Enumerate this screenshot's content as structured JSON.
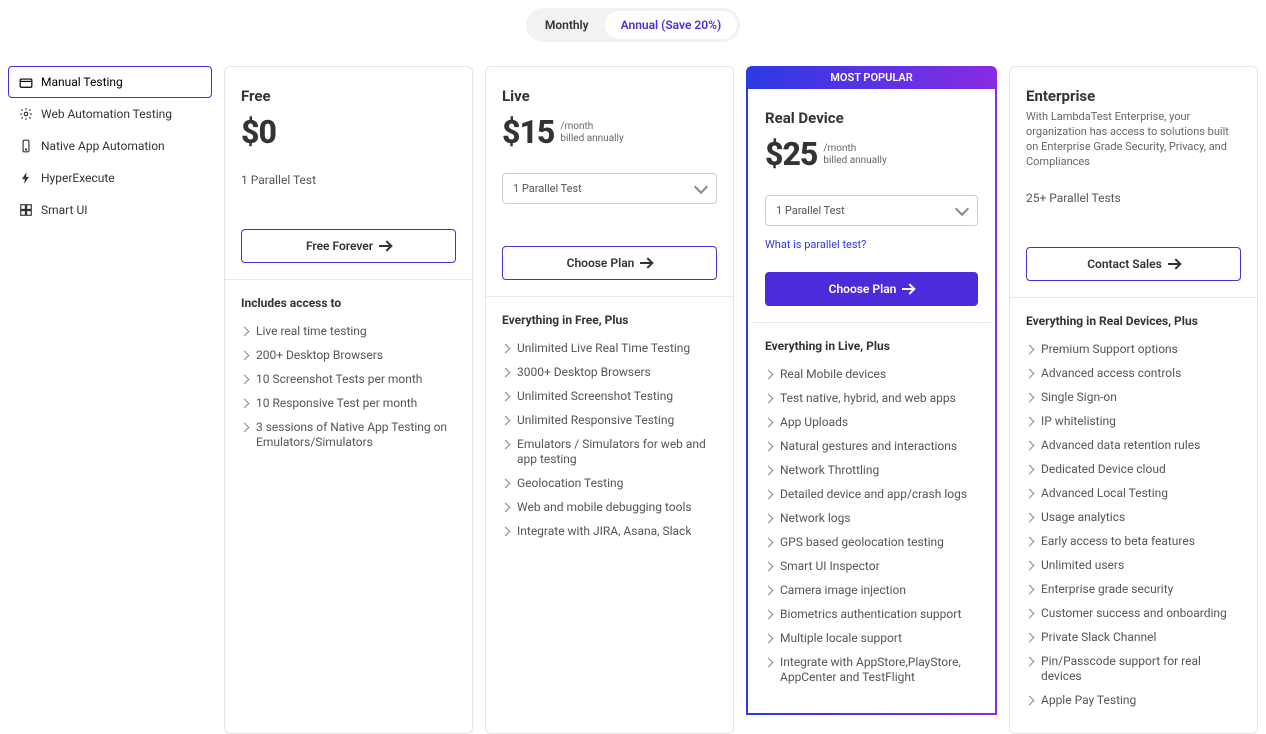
{
  "billing": {
    "monthly": "Monthly",
    "annual": "Annual (Save 20%)"
  },
  "sidebar": [
    {
      "label": "Manual Testing",
      "sel": true
    },
    {
      "label": "Web Automation Testing"
    },
    {
      "label": "Native App Automation"
    },
    {
      "label": "HyperExecute"
    },
    {
      "label": "Smart UI"
    }
  ],
  "plans": [
    {
      "title": "Free",
      "price": "$0",
      "period": "",
      "billed": "",
      "parallel": "1 Parallel Test",
      "parallel_select": false,
      "cta": "Free Forever",
      "popular": false,
      "section": "Includes access to",
      "features": [
        "Live real time testing",
        "200+ Desktop Browsers",
        "10 Screenshot Tests per month",
        "10 Responsive Test per month",
        "3 sessions of Native App Testing on Emulators/Simulators"
      ]
    },
    {
      "title": "Live",
      "price": "$15",
      "period": "/month",
      "billed": "billed annually",
      "parallel": "1 Parallel Test",
      "parallel_select": true,
      "cta": "Choose Plan",
      "popular": false,
      "section": "Everything in Free, Plus",
      "features": [
        "Unlimited Live Real Time Testing",
        "3000+ Desktop Browsers",
        "Unlimited Screenshot Testing",
        "Unlimited Responsive Testing",
        "Emulators / Simulators for web and app testing",
        "Geolocation Testing",
        "Web and mobile debugging tools",
        "Integrate with JIRA, Asana, Slack"
      ]
    },
    {
      "title": "Real Device",
      "price": "$25",
      "period": "/month",
      "billed": "billed annually",
      "parallel": "1 Parallel Test",
      "parallel_select": true,
      "link": "What is parallel test?",
      "cta": "Choose Plan",
      "popular": true,
      "popular_label": "MOST POPULAR",
      "section": "Everything in Live, Plus",
      "features": [
        "Real Mobile devices",
        "Test native, hybrid, and web apps",
        "App Uploads",
        "Natural gestures and interactions",
        "Network Throttling",
        "Detailed device and app/crash logs",
        "Network logs",
        "GPS based geolocation testing",
        "Smart UI Inspector",
        "Camera image injection",
        "Biometrics authentication support",
        "Multiple locale support",
        "Integrate with AppStore,PlayStore, AppCenter and TestFlight"
      ]
    },
    {
      "title": "Enterprise",
      "price": "",
      "period": "",
      "billed": "",
      "sub": "With LambdaTest Enterprise, your organization has access to solutions built on Enterprise Grade Security, Privacy, and Compliances",
      "parallel": "25+ Parallel Tests",
      "parallel_select": false,
      "cta": "Contact Sales",
      "popular": false,
      "section": "Everything in Real Devices, Plus",
      "features": [
        "Premium Support options",
        "Advanced access controls",
        "Single Sign-on",
        "IP whitelisting",
        "Advanced data retention rules",
        "Dedicated Device cloud",
        "Advanced Local Testing",
        "Usage analytics",
        "Early access to beta features",
        "Unlimited users",
        "Enterprise grade security",
        "Customer success and onboarding",
        "Private Slack Channel",
        "Pin/Passcode support for real devices",
        "Apple Pay Testing"
      ]
    }
  ]
}
